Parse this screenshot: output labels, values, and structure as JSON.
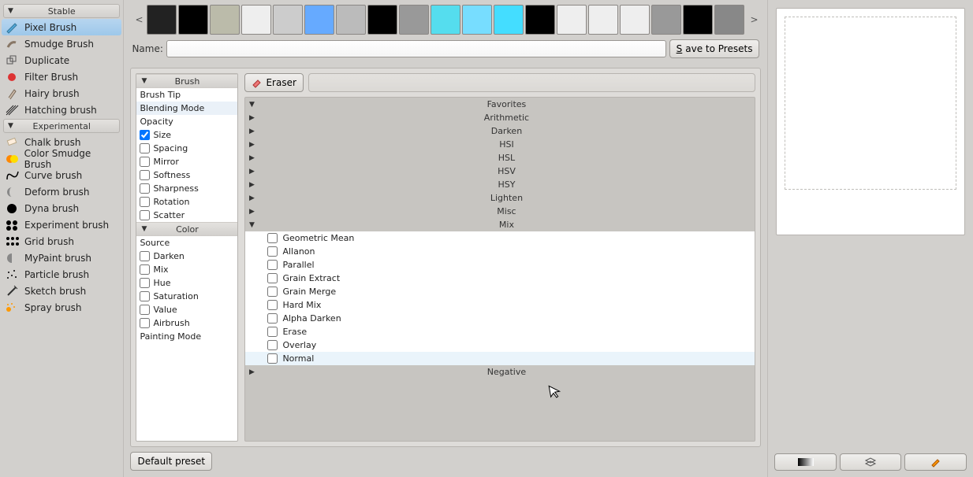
{
  "categories": {
    "stable": "Stable",
    "experimental": "Experimental"
  },
  "stable_brushes": [
    {
      "name": "Pixel Brush",
      "icon": "pixel",
      "selected": true
    },
    {
      "name": "Smudge Brush",
      "icon": "smudge"
    },
    {
      "name": "Duplicate",
      "icon": "duplicate"
    },
    {
      "name": "Filter Brush",
      "icon": "filter"
    },
    {
      "name": "Hairy brush",
      "icon": "hairy"
    },
    {
      "name": "Hatching brush",
      "icon": "hatching"
    }
  ],
  "experimental_brushes": [
    {
      "name": "Chalk brush",
      "icon": "chalk"
    },
    {
      "name": "Color Smudge Brush",
      "icon": "colorsmudge"
    },
    {
      "name": "Curve brush",
      "icon": "curve"
    },
    {
      "name": "Deform brush",
      "icon": "deform"
    },
    {
      "name": "Dyna brush",
      "icon": "dyna"
    },
    {
      "name": "Experiment brush",
      "icon": "experiment"
    },
    {
      "name": "Grid brush",
      "icon": "grid"
    },
    {
      "name": "MyPaint brush",
      "icon": "mypaint"
    },
    {
      "name": "Particle brush",
      "icon": "particle"
    },
    {
      "name": "Sketch brush",
      "icon": "sketch"
    },
    {
      "name": "Spray brush",
      "icon": "spray"
    }
  ],
  "presets": {
    "count": 19,
    "prev": "<",
    "next": ">"
  },
  "name_field": {
    "label": "Name:",
    "value": ""
  },
  "save_button": {
    "prefix": "S",
    "rest": "ave to Presets"
  },
  "option_groups": {
    "brush": "Brush",
    "color": "Color"
  },
  "brush_options": [
    {
      "label": "Brush Tip",
      "check": null
    },
    {
      "label": "Blending Mode",
      "check": null,
      "selected": true
    },
    {
      "label": "Opacity",
      "check": null
    },
    {
      "label": "Size",
      "check": true
    },
    {
      "label": "Spacing",
      "check": false
    },
    {
      "label": "Mirror",
      "check": false
    },
    {
      "label": "Softness",
      "check": false
    },
    {
      "label": "Sharpness",
      "check": false
    },
    {
      "label": "Rotation",
      "check": false
    },
    {
      "label": "Scatter",
      "check": false
    }
  ],
  "color_options": [
    {
      "label": "Source",
      "check": null
    },
    {
      "label": "Darken",
      "check": false
    },
    {
      "label": "Mix",
      "check": false
    },
    {
      "label": "Hue",
      "check": false
    },
    {
      "label": "Saturation",
      "check": false
    },
    {
      "label": "Value",
      "check": false
    },
    {
      "label": "Airbrush",
      "check": false
    },
    {
      "label": "Painting Mode",
      "check": null
    }
  ],
  "eraser_button": "Eraser",
  "blend_categories": [
    {
      "label": "Favorites",
      "open": true,
      "children": []
    },
    {
      "label": "Arithmetic",
      "open": false
    },
    {
      "label": "Darken",
      "open": false
    },
    {
      "label": "HSI",
      "open": false
    },
    {
      "label": "HSL",
      "open": false
    },
    {
      "label": "HSV",
      "open": false
    },
    {
      "label": "HSY",
      "open": false
    },
    {
      "label": "Lighten",
      "open": false
    },
    {
      "label": "Misc",
      "open": false
    },
    {
      "label": "Mix",
      "open": true,
      "children": [
        {
          "label": "Geometric Mean"
        },
        {
          "label": "Allanon"
        },
        {
          "label": "Parallel"
        },
        {
          "label": "Grain Extract"
        },
        {
          "label": "Grain Merge"
        },
        {
          "label": "Hard Mix"
        },
        {
          "label": "Alpha Darken"
        },
        {
          "label": "Erase"
        },
        {
          "label": "Overlay"
        },
        {
          "label": "Normal",
          "hover": true
        }
      ]
    },
    {
      "label": "Negative",
      "open": false
    }
  ],
  "default_preset_button": "Default preset"
}
